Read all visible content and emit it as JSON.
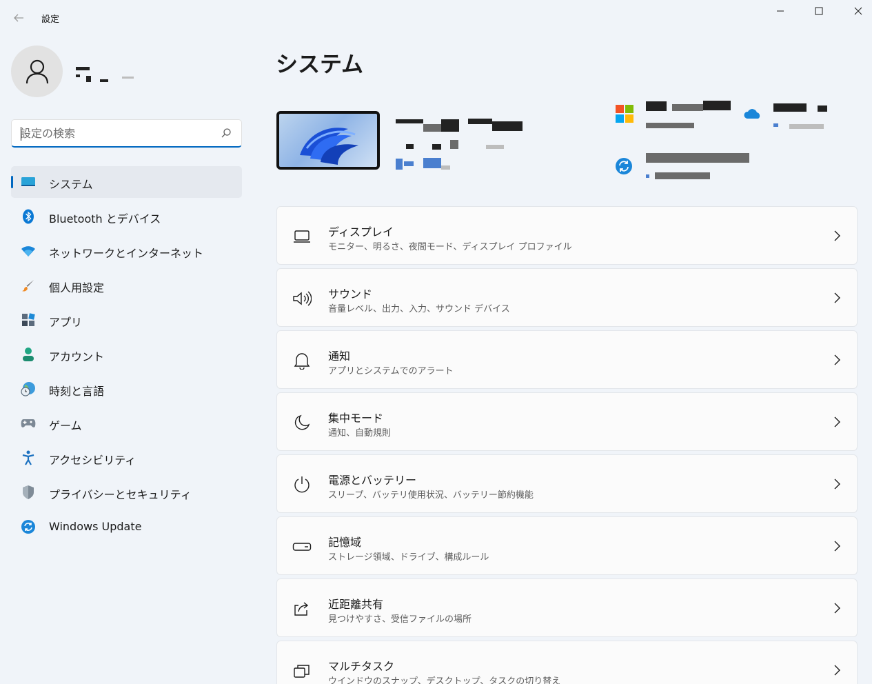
{
  "window": {
    "app_title": "設定",
    "buttons": {
      "minimize": "minimize",
      "maximize": "maximize",
      "close": "close"
    }
  },
  "search": {
    "placeholder": "設定の検索",
    "value": ""
  },
  "nav": {
    "items": [
      {
        "label": "システム",
        "icon": "system-icon",
        "active": true
      },
      {
        "label": "Bluetooth とデバイス",
        "icon": "bluetooth-icon"
      },
      {
        "label": "ネットワークとインターネット",
        "icon": "wifi-icon"
      },
      {
        "label": "個人用設定",
        "icon": "brush-icon"
      },
      {
        "label": "アプリ",
        "icon": "apps-icon"
      },
      {
        "label": "アカウント",
        "icon": "account-icon"
      },
      {
        "label": "時刻と言語",
        "icon": "globe-clock-icon"
      },
      {
        "label": "ゲーム",
        "icon": "gamepad-icon"
      },
      {
        "label": "アクセシビリティ",
        "icon": "accessibility-icon"
      },
      {
        "label": "プライバシーとセキュリティ",
        "icon": "shield-icon"
      },
      {
        "label": "Windows Update",
        "icon": "windows-update-icon"
      }
    ]
  },
  "main": {
    "title": "システム",
    "cards": [
      {
        "title": "ディスプレイ",
        "subtitle": "モニター、明るさ、夜間モード、ディスプレイ プロファイル",
        "icon": "display-icon"
      },
      {
        "title": "サウンド",
        "subtitle": "音量レベル、出力、入力、サウンド デバイス",
        "icon": "speaker-icon"
      },
      {
        "title": "通知",
        "subtitle": "アプリとシステムでのアラート",
        "icon": "bell-icon"
      },
      {
        "title": "集中モード",
        "subtitle": "通知、自動規則",
        "icon": "moon-icon"
      },
      {
        "title": "電源とバッテリー",
        "subtitle": "スリープ、バッテリ使用状況、バッテリー節約機能",
        "icon": "power-icon"
      },
      {
        "title": "記憶域",
        "subtitle": "ストレージ領域、ドライブ、構成ルール",
        "icon": "storage-icon"
      },
      {
        "title": "近距離共有",
        "subtitle": "見つけやすさ、受信ファイルの場所",
        "icon": "share-icon"
      },
      {
        "title": "マルチタスク",
        "subtitle": "ウインドウのスナップ、デスクトップ、タスクの切り替え",
        "icon": "multitask-icon"
      }
    ]
  },
  "colors": {
    "accent": "#0067c0",
    "background": "#f0f4f9",
    "card": "#fbfbfb"
  }
}
